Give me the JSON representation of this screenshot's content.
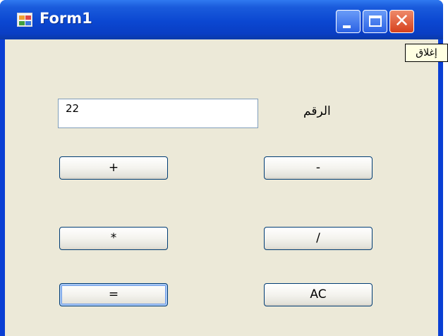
{
  "window": {
    "title": "Form1",
    "minimize_icon": "minimize-icon",
    "maximize_icon": "maximize-icon",
    "close_icon": "close-icon",
    "close_glyph": "✕",
    "tooltip": "إغلاق"
  },
  "form": {
    "number_label": "الرقم",
    "number_value": "22",
    "buttons": {
      "plus": "+",
      "minus": "-",
      "multiply": "*",
      "divide": "/",
      "equals": "=",
      "clear": "AC"
    }
  },
  "colors": {
    "titlebar": "#0b47d1",
    "client_background": "#ece9d8",
    "tooltip_background": "#ffffe1",
    "close_button": "#d6401c"
  }
}
